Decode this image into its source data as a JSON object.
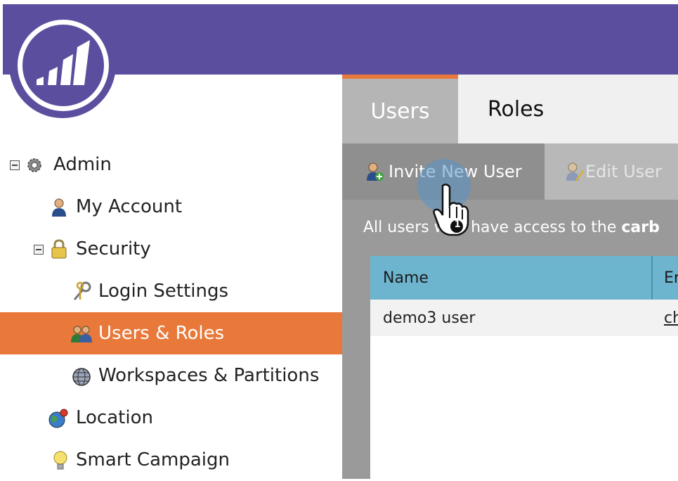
{
  "header": {
    "brand_color": "#5c4e9e",
    "logo_icon": "signal-bars-logo"
  },
  "sidebar": {
    "items": [
      {
        "label": "Admin",
        "icon": "gear-icon"
      },
      {
        "label": "My Account",
        "icon": "user-icon"
      },
      {
        "label": "Security",
        "icon": "lock-icon"
      },
      {
        "label": "Login Settings",
        "icon": "keys-icon"
      },
      {
        "label": "Users & Roles",
        "icon": "users-icon"
      },
      {
        "label": "Workspaces & Partitions",
        "icon": "globe-icon"
      },
      {
        "label": "Location",
        "icon": "location-globe-icon"
      },
      {
        "label": "Smart Campaign",
        "icon": "lightbulb-icon"
      }
    ],
    "selected_color": "#e8793a"
  },
  "tabs": [
    {
      "label": "Users"
    },
    {
      "label": "Roles"
    }
  ],
  "toolbar": {
    "invite_label": "Invite New User",
    "edit_label": "Edit User"
  },
  "description": {
    "prefix": "All users w",
    "hidden": "ho",
    "middle": " have access to the ",
    "bold": "carb"
  },
  "table": {
    "columns": [
      "Name",
      "Er"
    ],
    "rows": [
      {
        "name": "demo3 user",
        "email": "ch"
      }
    ]
  },
  "cursor": {
    "step_badge": "1"
  }
}
